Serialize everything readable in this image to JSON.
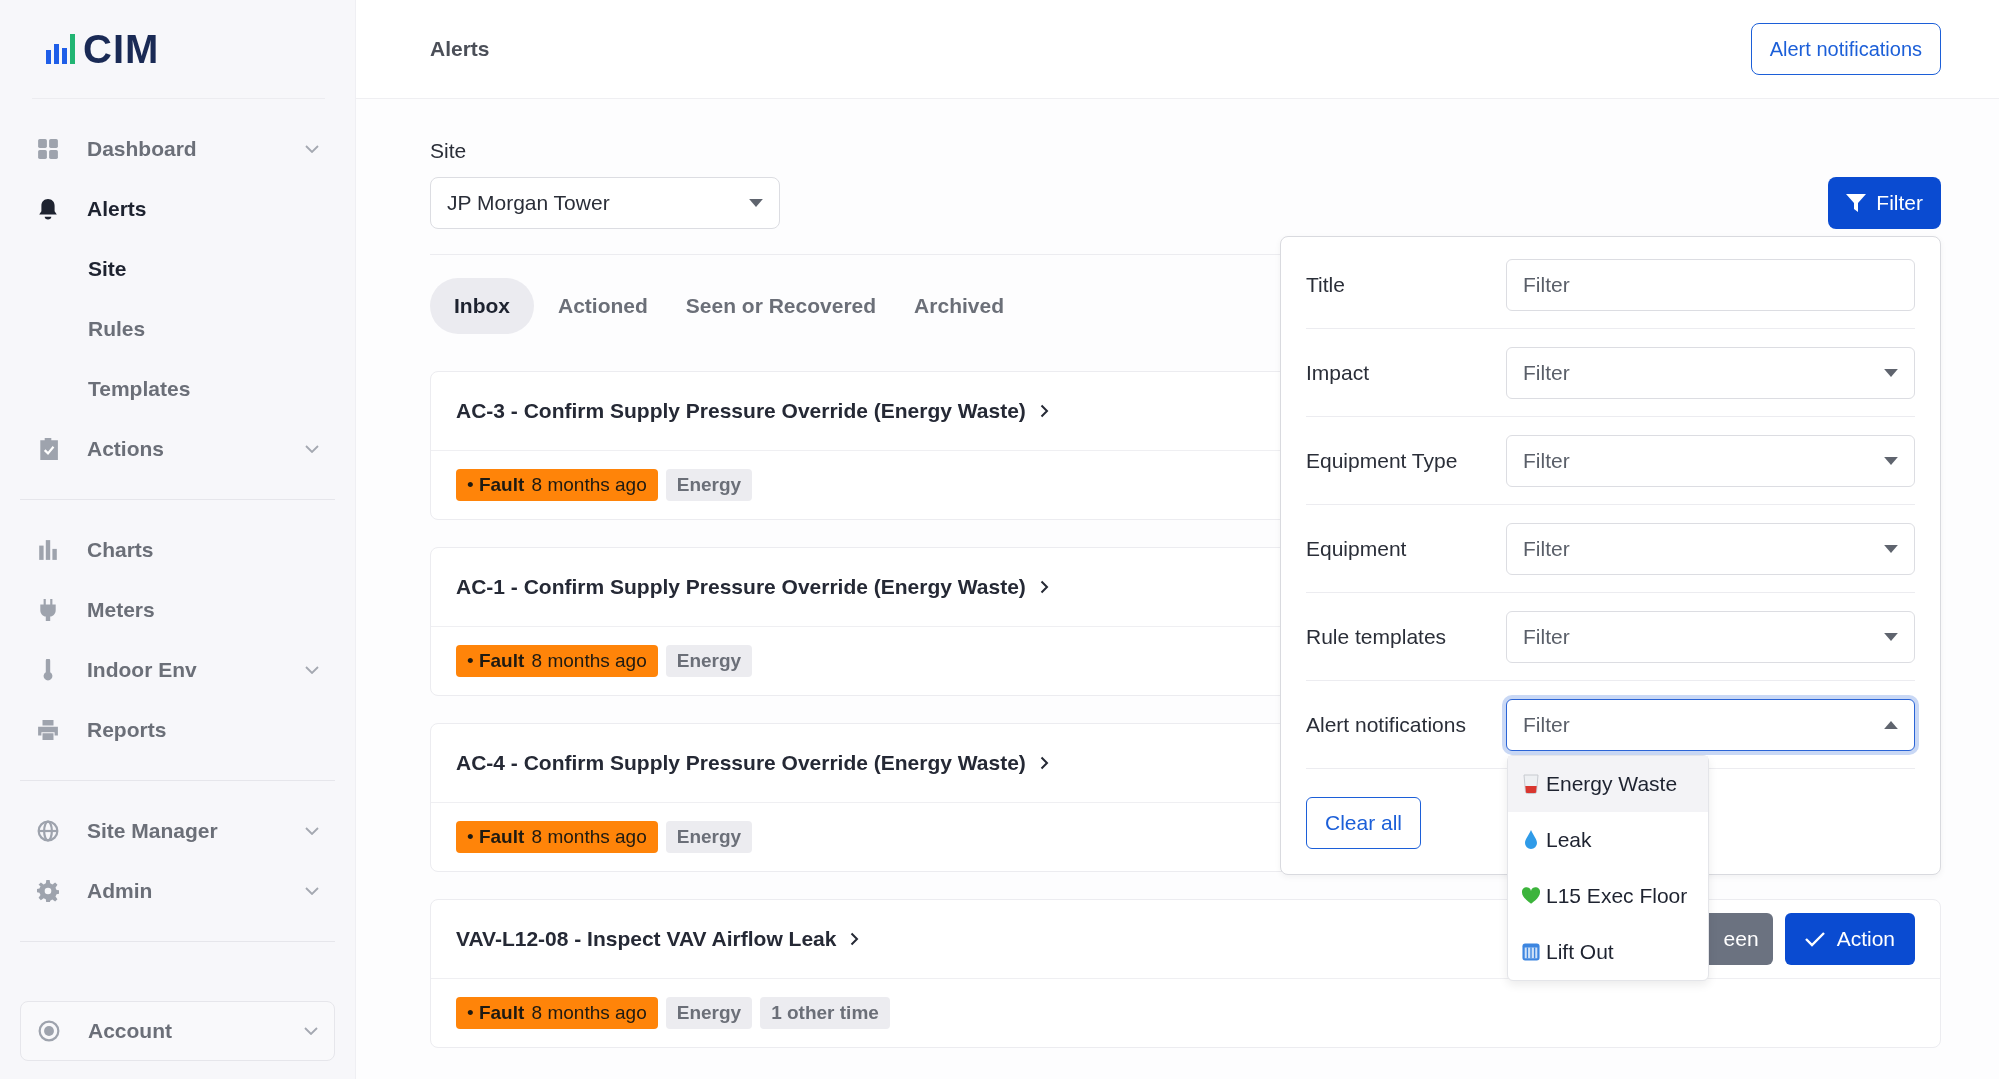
{
  "logo": {
    "text": "CIM"
  },
  "sidebar": {
    "groups": [
      {
        "items": [
          {
            "label": "Dashboard",
            "selected": false,
            "has_children": true
          },
          {
            "label": "Alerts",
            "selected": true,
            "has_children": false,
            "children": [
              {
                "label": "Site",
                "selected": true
              },
              {
                "label": "Rules",
                "selected": false
              },
              {
                "label": "Templates",
                "selected": false
              }
            ]
          },
          {
            "label": "Actions",
            "selected": false,
            "has_children": true
          }
        ]
      },
      {
        "items": [
          {
            "label": "Charts",
            "selected": false,
            "has_children": false
          },
          {
            "label": "Meters",
            "selected": false,
            "has_children": false
          },
          {
            "label": "Indoor Env",
            "selected": false,
            "has_children": true
          },
          {
            "label": "Reports",
            "selected": false,
            "has_children": false
          }
        ]
      },
      {
        "items": [
          {
            "label": "Site Manager",
            "selected": false,
            "has_children": true
          },
          {
            "label": "Admin",
            "selected": false,
            "has_children": true
          }
        ]
      }
    ],
    "account": {
      "label": "Account",
      "has_children": true
    }
  },
  "header": {
    "title": "Alerts",
    "button": "Alert notifications"
  },
  "site": {
    "label": "Site",
    "value": "JP Morgan Tower"
  },
  "filter_button": "Filter",
  "tabs": [
    {
      "label": "Inbox",
      "selected": true
    },
    {
      "label": "Actioned",
      "selected": false
    },
    {
      "label": "Seen or Recovered",
      "selected": false
    },
    {
      "label": "Archived",
      "selected": false
    }
  ],
  "alerts": [
    {
      "title": "AC-3 - Confirm Supply Pressure Override (Energy Waste)",
      "status": "• **Fault** 8 months ago",
      "tags": [
        "Energy"
      ]
    },
    {
      "title": "AC-1 - Confirm Supply Pressure Override (Energy Waste)",
      "status": "• **Fault** 8 months ago",
      "tags": [
        "Energy"
      ]
    },
    {
      "title": "AC-4 - Confirm Supply Pressure Override (Energy Waste)",
      "status": "• **Fault** 8 months ago",
      "tags": [
        "Energy"
      ]
    },
    {
      "title": "VAV-L12-08 - Inspect VAV Airflow Leak",
      "status": "• **Fault** 8 months ago",
      "tags": [
        "Energy",
        "1 other time"
      ],
      "buttons": [
        {
          "label": "een",
          "kind": "secondary"
        },
        {
          "label": "Action",
          "kind": "primary"
        }
      ]
    }
  ],
  "filter_panel": {
    "fields": [
      {
        "label": "Title",
        "kind": "text",
        "placeholder": "Filter"
      },
      {
        "label": "Impact",
        "kind": "select",
        "placeholder": "Filter",
        "expanded": false
      },
      {
        "label": "Equipment Type",
        "kind": "select",
        "placeholder": "Filter",
        "expanded": false
      },
      {
        "label": "Equipment",
        "kind": "select",
        "placeholder": "Filter",
        "expanded": false
      },
      {
        "label": "Rule templates",
        "kind": "select",
        "placeholder": "Filter",
        "expanded": false
      },
      {
        "label": "Alert notifications",
        "kind": "select",
        "placeholder": "Filter",
        "expanded": true,
        "options": [
          {
            "label": "Energy Waste",
            "highlighted": true
          },
          {
            "label": "Leak",
            "highlighted": false
          },
          {
            "label": "L15 Exec Floor",
            "highlighted": false
          },
          {
            "label": "Lift Out",
            "highlighted": false
          }
        ]
      }
    ],
    "clear_button": "Clear all"
  }
}
